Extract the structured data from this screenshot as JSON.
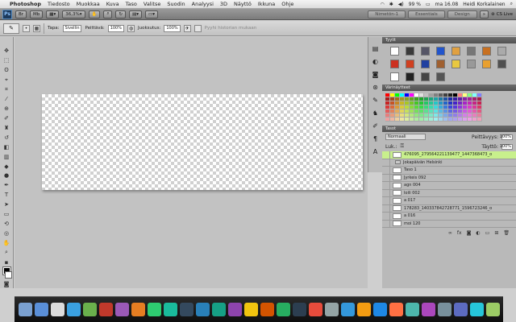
{
  "menubar": {
    "app": "Photoshop",
    "items": [
      "Tiedosto",
      "Muokkaa",
      "Kuva",
      "Taso",
      "Valitse",
      "Suodin",
      "Analyysi",
      "3D",
      "Näyttö",
      "Ikkuna",
      "Ohje"
    ],
    "battery": "99 %",
    "clock": "ma 16.08",
    "user": "Heidi Korkalainen"
  },
  "appbar": {
    "zoom": "36,3",
    "workspace_buttons": [
      "Nimetön-1",
      "Essentials",
      "Design"
    ],
    "more": "»",
    "cs_live": "CS Live"
  },
  "options": {
    "type_label": "Tapa:",
    "type_value": "Sivellin",
    "pressure_label": "Peittävä:",
    "pressure_value": "100%",
    "flow_label": "Juoksutus:",
    "flow_value": "100%",
    "history_label": "Pyyhi historian mukaan"
  },
  "panels": {
    "presets_tab": "Tyylit",
    "swatches_tab": "Värinäytteet",
    "layers_tab": "Tasot",
    "blend_mode": "Normaali",
    "opacity_label": "Peittävyys:",
    "opacity_value": "100%",
    "lock_label": "Luk.:",
    "fill_label": "Täyttö:",
    "fill_value": "100%",
    "layers": [
      {
        "name": "476095_279564221139477_1447368473_o",
        "selected": true,
        "group": false
      },
      {
        "name": "Jokapäivän Helsinki",
        "selected": false,
        "group": true
      },
      {
        "name": "Taso 1",
        "selected": false,
        "group": false
      },
      {
        "name": "Jyrkeis 092",
        "selected": false,
        "group": false
      },
      {
        "name": "agn 004",
        "selected": false,
        "group": false
      },
      {
        "name": "loili 002",
        "selected": false,
        "group": false
      },
      {
        "name": "a 017",
        "selected": false,
        "group": false
      },
      {
        "name": "178283_140337842728771_1596723246_o",
        "selected": false,
        "group": false
      },
      {
        "name": "a 016",
        "selected": false,
        "group": false
      },
      {
        "name": "moi 120",
        "selected": false,
        "group": false
      }
    ]
  },
  "colors": {
    "menubar_bg": "#e8e8e8",
    "appbar_bg": "#888888",
    "selected_layer": "#c8f08c",
    "dock_bg": "#1a1a1a"
  }
}
